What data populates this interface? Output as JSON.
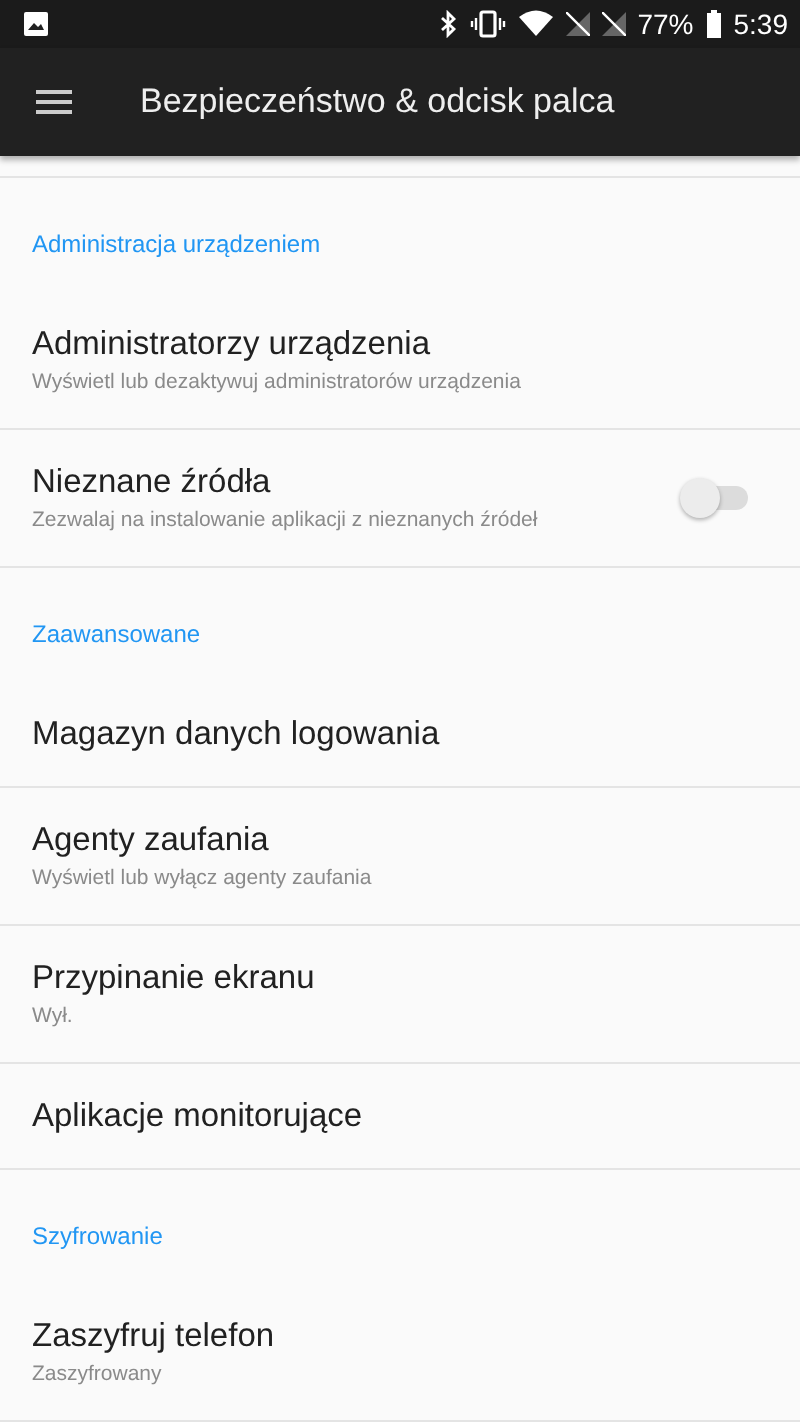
{
  "status_bar": {
    "battery": "77%",
    "time": "5:39"
  },
  "toolbar": {
    "title": "Bezpieczeństwo & odcisk palca"
  },
  "sections": [
    {
      "header": "Administracja urządzeniem",
      "items": [
        {
          "kind": "plain",
          "title": "Administratorzy urządzenia",
          "summary": "Wyświetl lub dezaktywuj administratorów urządzenia"
        },
        {
          "kind": "switch",
          "title": "Nieznane źródła",
          "summary": "Zezwalaj na instalowanie aplikacji z nieznanych źródeł",
          "on": false
        }
      ]
    },
    {
      "header": "Zaawansowane",
      "items": [
        {
          "kind": "plain",
          "title": "Magazyn danych logowania"
        },
        {
          "kind": "plain",
          "title": "Agenty zaufania",
          "summary": "Wyświetl lub wyłącz agenty zaufania"
        },
        {
          "kind": "plain",
          "title": "Przypinanie ekranu",
          "summary": "Wył."
        },
        {
          "kind": "plain",
          "title": "Aplikacje monitorujące"
        }
      ]
    },
    {
      "header": "Szyfrowanie",
      "items": [
        {
          "kind": "plain",
          "title": "Zaszyfruj telefon",
          "summary": "Zaszyfrowany"
        }
      ]
    }
  ]
}
